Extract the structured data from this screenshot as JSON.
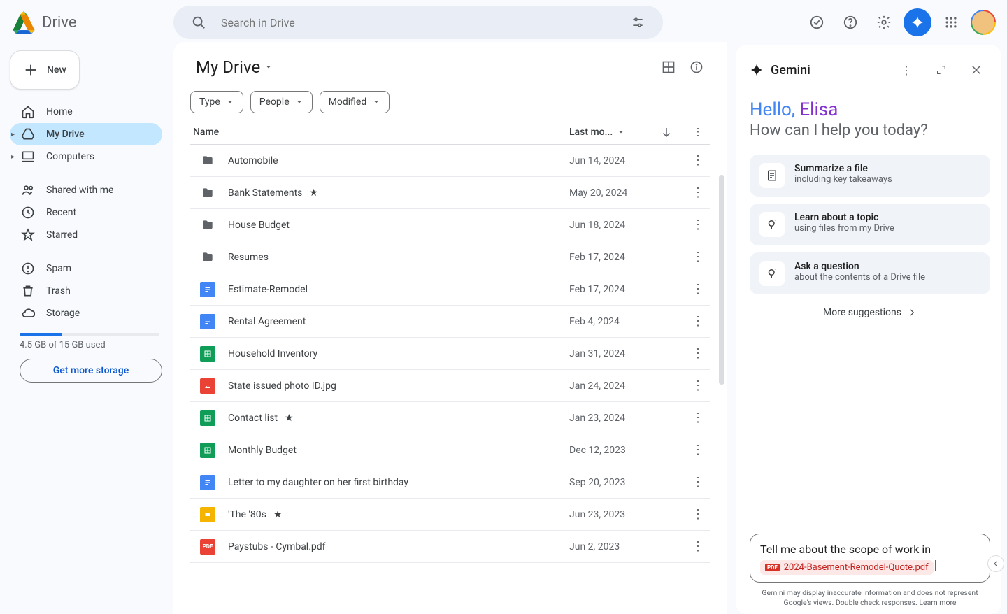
{
  "app": {
    "name": "Drive"
  },
  "search": {
    "placeholder": "Search in Drive"
  },
  "sidebar": {
    "new_label": "New",
    "items": [
      {
        "label": "Home",
        "icon": "home"
      },
      {
        "label": "My Drive",
        "icon": "drive",
        "active": true,
        "expandable": true
      },
      {
        "label": "Computers",
        "icon": "computer",
        "expandable": true
      }
    ],
    "items2": [
      {
        "label": "Shared with me",
        "icon": "people"
      },
      {
        "label": "Recent",
        "icon": "clock"
      },
      {
        "label": "Starred",
        "icon": "star"
      }
    ],
    "items3": [
      {
        "label": "Spam",
        "icon": "spam"
      },
      {
        "label": "Trash",
        "icon": "trash"
      },
      {
        "label": "Storage",
        "icon": "cloud"
      }
    ],
    "storage_text": "4.5 GB of 15 GB used",
    "storage_pct": 30,
    "get_storage": "Get more storage"
  },
  "main": {
    "title": "My Drive",
    "filters": [
      "Type",
      "People",
      "Modified"
    ],
    "columns": {
      "name": "Name",
      "date": "Last mo..."
    },
    "files": [
      {
        "name": "Automobile",
        "type": "folder",
        "date": "Jun 14, 2024"
      },
      {
        "name": "Bank Statements",
        "type": "folder",
        "date": "May 20, 2024",
        "starred": true
      },
      {
        "name": "House Budget",
        "type": "folder",
        "date": "Jun 18, 2024"
      },
      {
        "name": "Resumes",
        "type": "folder",
        "date": "Feb 17, 2024"
      },
      {
        "name": "Estimate-Remodel",
        "type": "doc",
        "date": "Feb 17, 2024"
      },
      {
        "name": "Rental Agreement",
        "type": "doc",
        "date": "Feb 4, 2024"
      },
      {
        "name": "Household Inventory",
        "type": "sheet",
        "date": "Jan 31, 2024"
      },
      {
        "name": "State issued photo ID.jpg",
        "type": "image",
        "date": "Jan 24, 2024"
      },
      {
        "name": "Contact list",
        "type": "sheet",
        "date": "Jan 23, 2024",
        "starred": true
      },
      {
        "name": "Monthly Budget",
        "type": "sheet",
        "date": "Dec 12, 2023"
      },
      {
        "name": "Letter to my daughter on her first birthday",
        "type": "doc",
        "date": "Sep 20, 2023"
      },
      {
        "name": "'The '80s",
        "type": "slide",
        "date": "Jun 23, 2023",
        "starred": true
      },
      {
        "name": "Paystubs - Cymbal.pdf",
        "type": "pdf",
        "date": "Jun 2, 2023"
      }
    ]
  },
  "gemini": {
    "title": "Gemini",
    "hello_pre": "Hello, ",
    "hello_name": "Elisa",
    "subtitle": "How can I help you today?",
    "suggestions": [
      {
        "title": "Summarize a file",
        "desc": "including key takeaways",
        "icon": "summary"
      },
      {
        "title": "Learn about a topic",
        "desc": "using files from my Drive",
        "icon": "bulb"
      },
      {
        "title": "Ask a question",
        "desc": "about the contents of a Drive file",
        "icon": "bulb"
      }
    ],
    "more": "More suggestions",
    "input_text": "Tell me about the scope of work in",
    "attachment": "2024-Basement-Remodel-Quote.pdf",
    "disclaimer_a": "Gemini may display inaccurate information and does not represent Google's views. Double check responses. ",
    "disclaimer_link": "Learn more"
  }
}
